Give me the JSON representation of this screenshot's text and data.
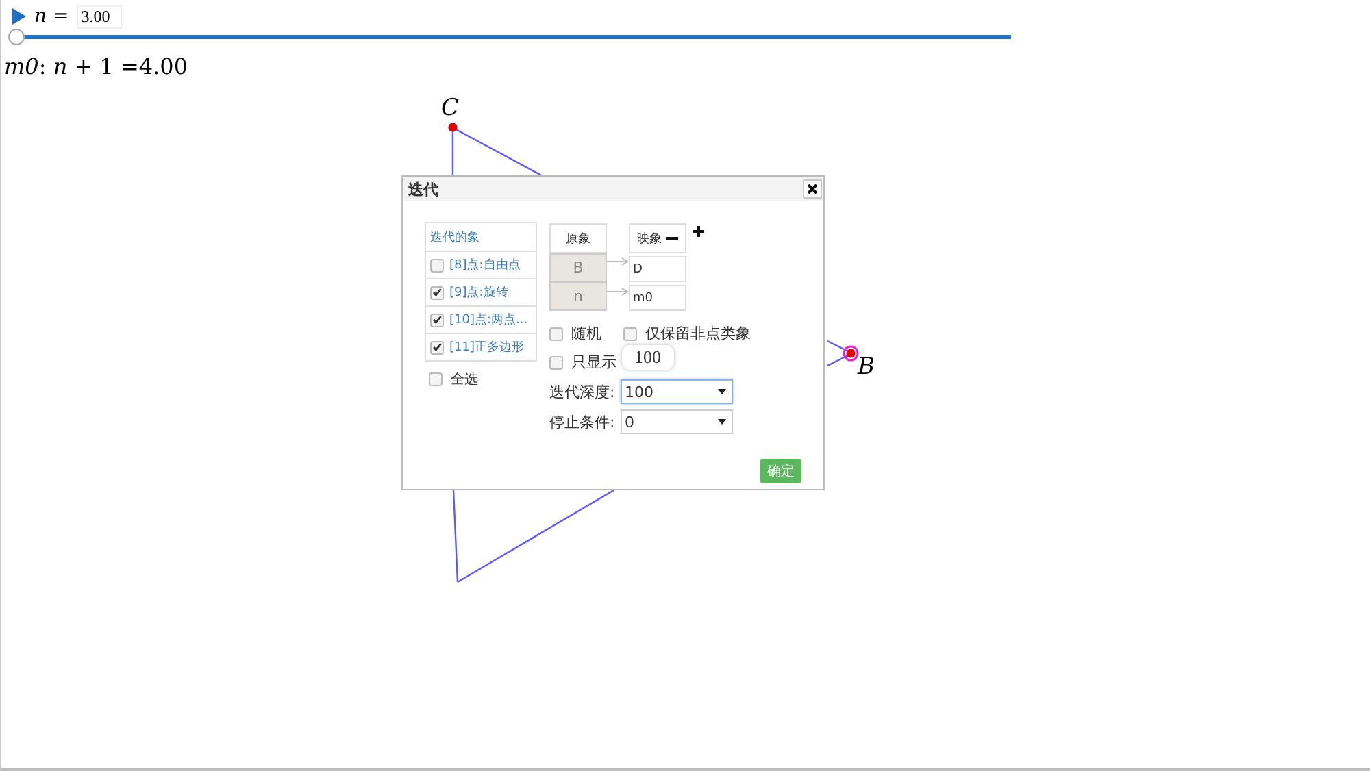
{
  "slider": {
    "variable": "n",
    "equals": "=",
    "value": "3.00",
    "level": 0
  },
  "formula": "*m0*: *n* + 1 =4.00",
  "canvas": {
    "points": [
      {
        "label": "C",
        "selected": false
      },
      {
        "label": "B",
        "selected": true
      }
    ]
  },
  "dialog": {
    "title": "迭代",
    "objects": {
      "header": "迭代的象",
      "items": [
        {
          "label": "[8]点:自由点",
          "checked": false
        },
        {
          "label": "[9]点:旋转",
          "checked": true
        },
        {
          "label": "[10]点:两点...",
          "checked": true
        },
        {
          "label": "[11]正多边形",
          "checked": true
        }
      ],
      "select_all": {
        "label": "全选",
        "checked": false
      }
    },
    "mapping": {
      "source_header": "原象",
      "target_header": "映象",
      "rows": [
        {
          "source": "B",
          "target": "D"
        },
        {
          "source": "n",
          "target": "m0"
        }
      ]
    },
    "options": [
      {
        "label": "随机",
        "checked": false
      },
      {
        "label": "仅保留非点类象",
        "checked": false
      },
      {
        "label": "只显示",
        "checked": false
      }
    ],
    "tooltip": "100",
    "depth": {
      "label": "迭代深度:",
      "value": "100"
    },
    "stop": {
      "label": "停止条件:",
      "value": "0"
    },
    "confirm": "确定"
  }
}
